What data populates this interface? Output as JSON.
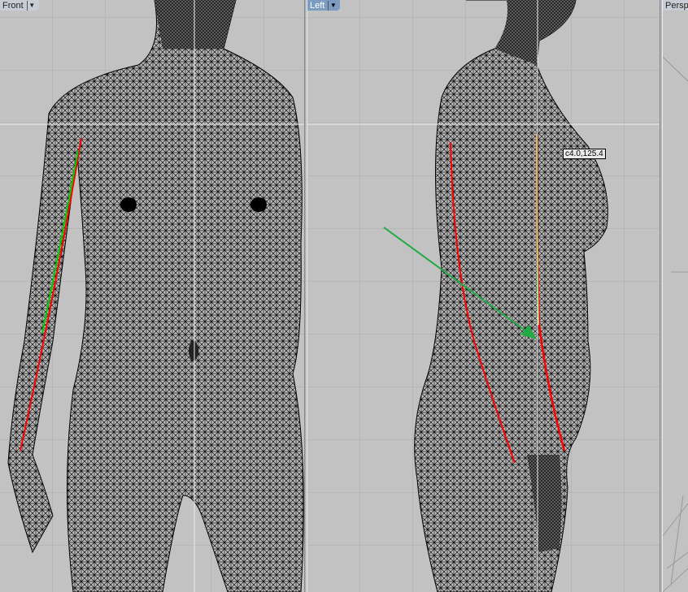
{
  "viewports": [
    {
      "name": "Front",
      "active": false
    },
    {
      "name": "Left",
      "active": true
    },
    {
      "name": "Persp",
      "active": false
    }
  ],
  "cursor_readout": "c4.0,125.4",
  "colors": {
    "background": "#c2c2c2",
    "grid": "#a9a9a9",
    "curve": "#ff0000",
    "highlight": "#00cc00",
    "arrow": "#22aa44",
    "active_label": "#7d9cc2"
  }
}
